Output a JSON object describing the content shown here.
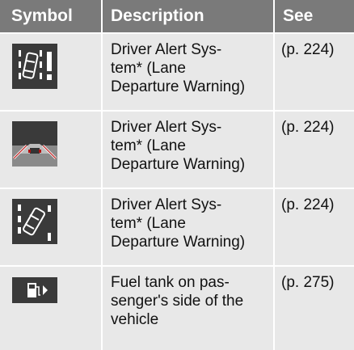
{
  "header": {
    "symbol": "Symbol",
    "description": "Description",
    "see": "See"
  },
  "rows": [
    {
      "icon": "lane-departure-warning-car-icon",
      "description": "Driver Alert Sys-\ntem* (Lane\nDeparture Warning)",
      "see": "(p. 224)"
    },
    {
      "icon": "lane-departure-road-view-icon",
      "description": "Driver Alert Sys-\ntem* (Lane\nDeparture Warning)",
      "see": "(p. 224)"
    },
    {
      "icon": "lane-departure-car-crossing-icon",
      "description": "Driver Alert Sys-\ntem* (Lane\nDeparture Warning)",
      "see": "(p. 224)"
    },
    {
      "icon": "fuel-tank-side-icon",
      "description": "Fuel tank on pas-\nsenger's side of the\nvehicle",
      "see": "(p. 275)"
    }
  ],
  "colors": {
    "header_bg": "#7a7a7a",
    "row_bg": "#e8e8e8",
    "icon_bg": "#3a3a3a"
  }
}
